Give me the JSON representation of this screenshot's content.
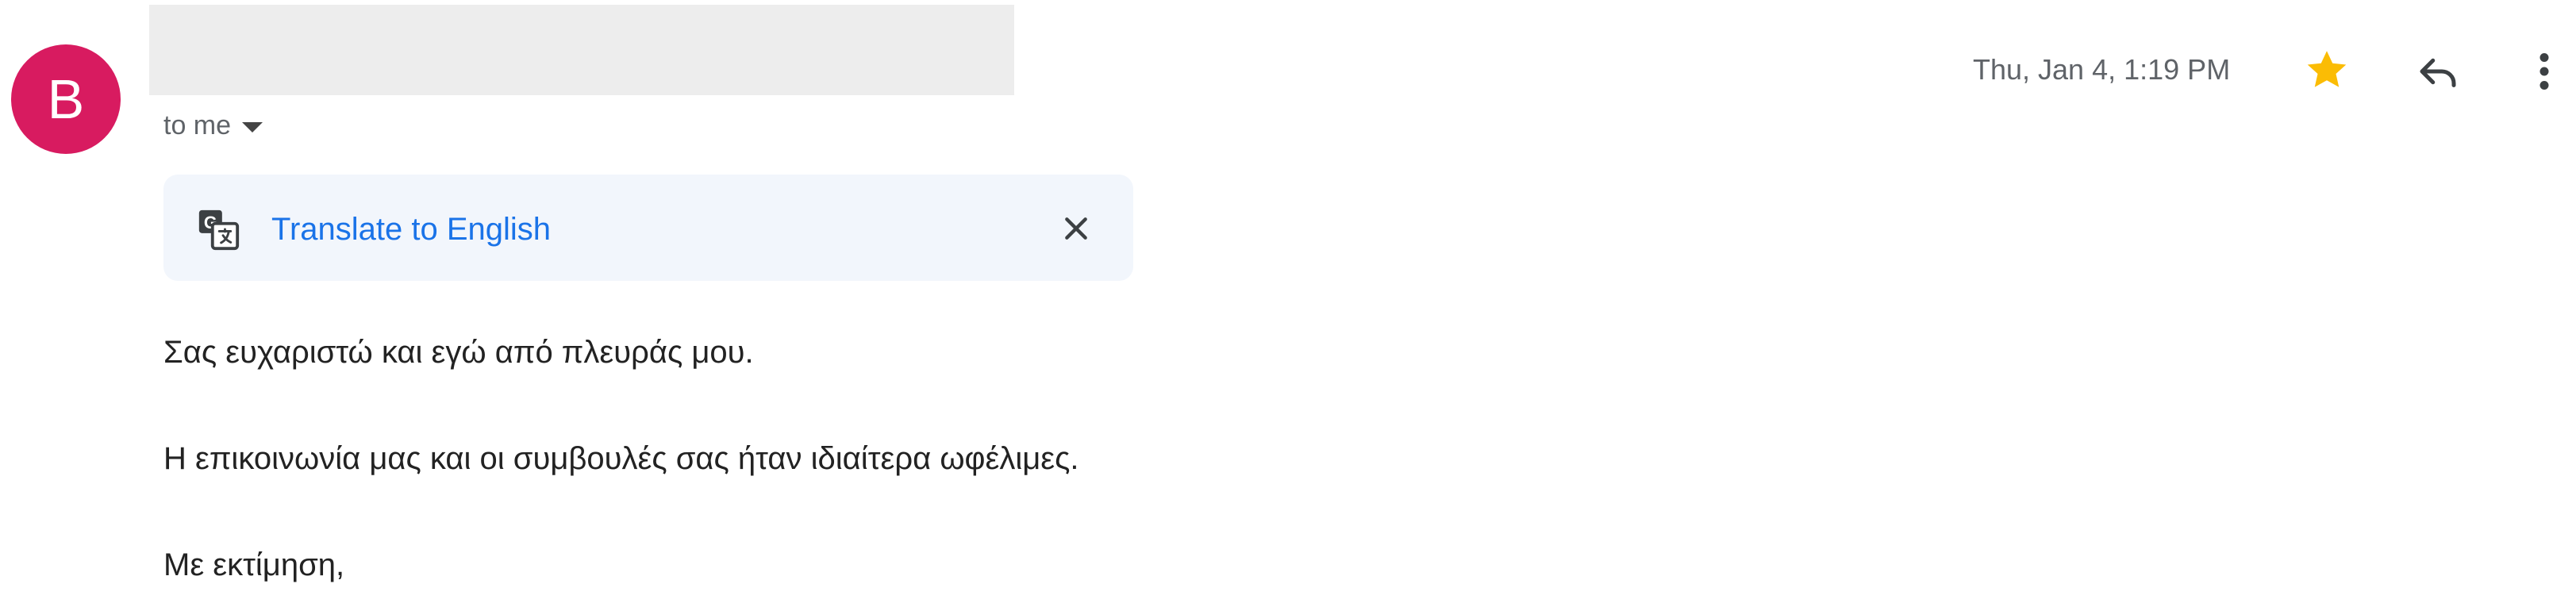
{
  "sender": {
    "avatar_letter": "B",
    "avatar_color": "#d81b60"
  },
  "recipient_label": "to me",
  "date": "Thu, Jan 4, 1:19 PM",
  "icons": {
    "recipient_details": "chevron-down-icon",
    "star": "star-icon",
    "reply": "reply-icon",
    "more": "more-vert-icon",
    "translate": "translate-icon",
    "close": "close-icon"
  },
  "star_color": "#fbbc04",
  "translate_bar": {
    "link_label": "Translate to English",
    "link_color": "#1a73e8"
  },
  "body_lines": [
    "Σας ευχαριστώ και εγώ από πλευράς μου.",
    "Η επικοινωνία μας και οι συμβουλές σας ήταν ιδιαίτερα ωφέλιμες.",
    "Με εκτίμηση,"
  ]
}
